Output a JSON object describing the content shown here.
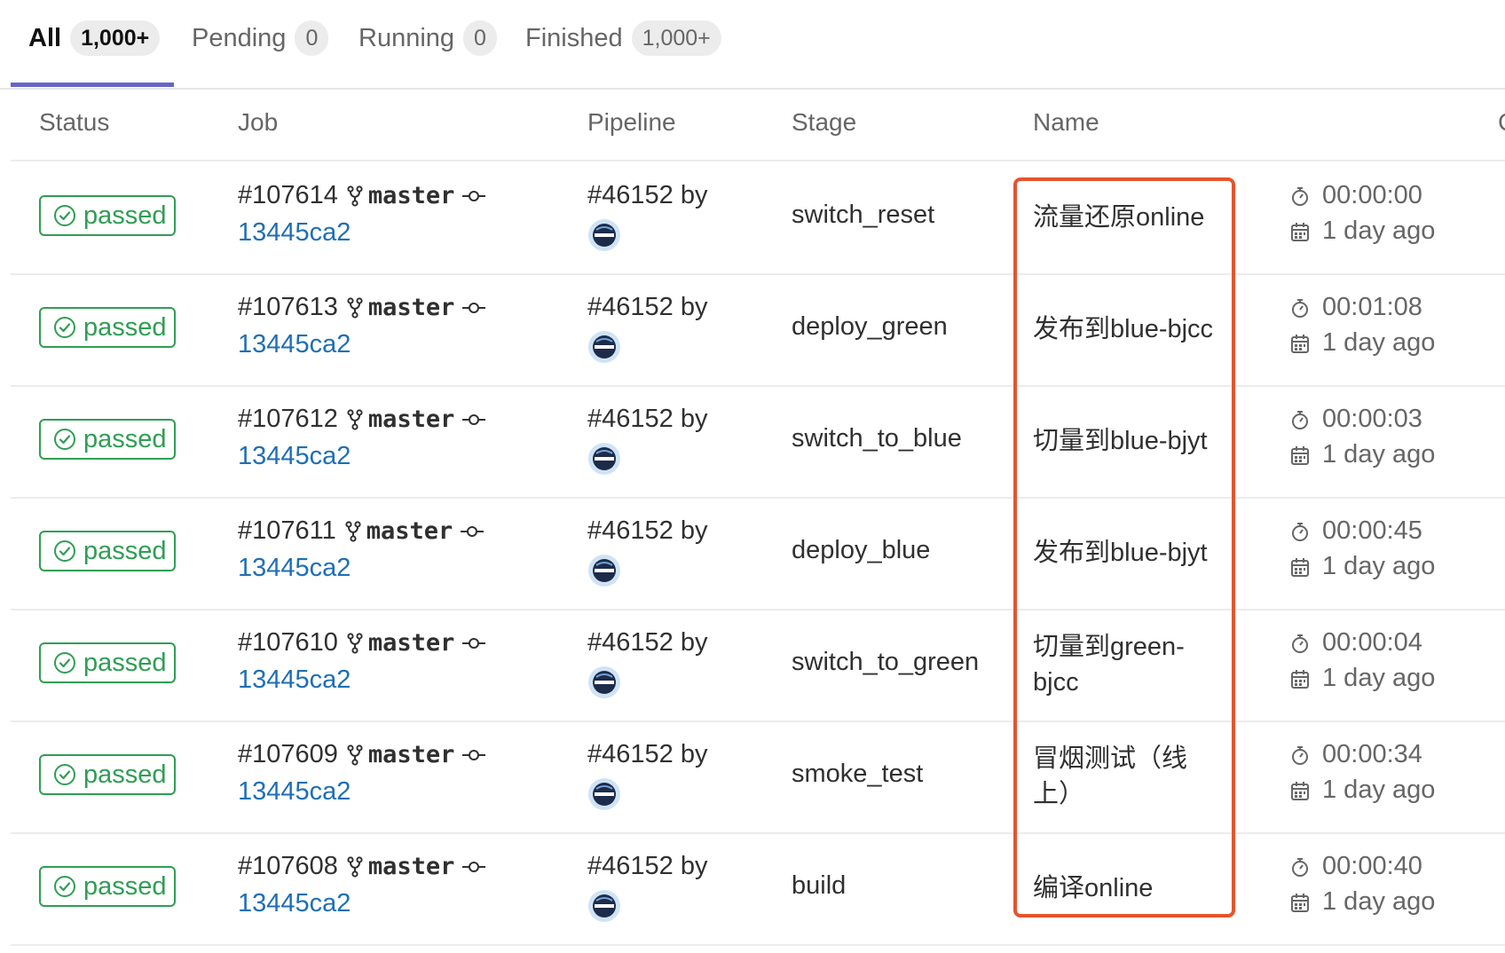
{
  "tabs": [
    {
      "label": "All",
      "count": "1,000+"
    },
    {
      "label": "Pending",
      "count": "0"
    },
    {
      "label": "Running",
      "count": "0"
    },
    {
      "label": "Finished",
      "count": "1,000+"
    }
  ],
  "columns": {
    "status": "Status",
    "job": "Job",
    "pipeline": "Pipeline",
    "stage": "Stage",
    "name": "Name",
    "extra": "C"
  },
  "rows": [
    {
      "status": "passed",
      "job_id": "#107614",
      "branch": "master",
      "sha": "13445ca2",
      "pipeline": "#46152 by",
      "stage": "switch_reset",
      "name": "流量还原online",
      "duration": "00:00:00",
      "finished": "1 day ago"
    },
    {
      "status": "passed",
      "job_id": "#107613",
      "branch": "master",
      "sha": "13445ca2",
      "pipeline": "#46152 by",
      "stage": "deploy_green",
      "name": "发布到blue-bjcc",
      "duration": "00:01:08",
      "finished": "1 day ago"
    },
    {
      "status": "passed",
      "job_id": "#107612",
      "branch": "master",
      "sha": "13445ca2",
      "pipeline": "#46152 by",
      "stage": "switch_to_blue",
      "name": "切量到blue-bjyt",
      "duration": "00:00:03",
      "finished": "1 day ago"
    },
    {
      "status": "passed",
      "job_id": "#107611",
      "branch": "master",
      "sha": "13445ca2",
      "pipeline": "#46152 by",
      "stage": "deploy_blue",
      "name": "发布到blue-bjyt",
      "duration": "00:00:45",
      "finished": "1 day ago"
    },
    {
      "status": "passed",
      "job_id": "#107610",
      "branch": "master",
      "sha": "13445ca2",
      "pipeline": "#46152 by",
      "stage": "switch_to_green",
      "name": "切量到green-bjcc",
      "duration": "00:00:04",
      "finished": "1 day ago"
    },
    {
      "status": "passed",
      "job_id": "#107609",
      "branch": "master",
      "sha": "13445ca2",
      "pipeline": "#46152 by",
      "stage": "smoke_test",
      "name": "冒烟测试（线上）",
      "duration": "00:00:34",
      "finished": "1 day ago"
    },
    {
      "status": "passed",
      "job_id": "#107608",
      "branch": "master",
      "sha": "13445ca2",
      "pipeline": "#46152 by",
      "stage": "build",
      "name": "编译online",
      "duration": "00:00:40",
      "finished": "1 day ago"
    }
  ],
  "colors": {
    "passed": "#2f9e54",
    "link": "#1f6fb5",
    "active_tab": "#6666c4",
    "highlight": "#e5542f"
  },
  "icons": {
    "status": "check-circle-icon",
    "branch": "fork-icon",
    "commit": "commit-icon",
    "duration": "stopwatch-icon",
    "finished": "calendar-icon"
  }
}
